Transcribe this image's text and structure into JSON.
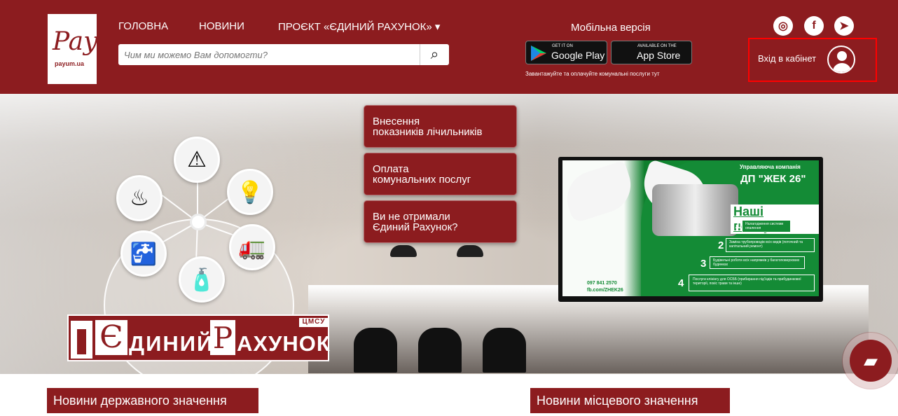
{
  "logo": {
    "script": "Pay",
    "site": "payum.ua"
  },
  "nav": {
    "home": "ГОЛОВНА",
    "news": "НОВИНИ",
    "project": "ПРОЄКТ «ЄДИНИЙ РАХУНОК» ▾"
  },
  "search": {
    "placeholder": "Чим ми можемо Вам допомогти?"
  },
  "mobile": {
    "title": "Мобільна версія",
    "google_sub": "GET IT ON",
    "google_main": "Google Play",
    "apple_sub": "Available on the",
    "apple_main": "App Store",
    "note": "Завантажуйте та оплачуйте комунальні послуги тут"
  },
  "social": [
    "instagram-icon",
    "facebook-icon",
    "telegram-icon"
  ],
  "cabinet": {
    "label": "Вхід в кабінет"
  },
  "quick_links": [
    {
      "label": "Внесення\nпоказників лічильників"
    },
    {
      "label": "Оплата\nкомунальних послуг"
    },
    {
      "label": "Ви не отримали\nЄдиний Рахунок?"
    }
  ],
  "brand": {
    "e": "Є",
    "word1": "ДИНИЙ",
    "p": "Р",
    "word2": "АХУНОК",
    "tag": "ЦМСУ"
  },
  "tv": {
    "company": "Управляюча компанія",
    "name": "ДП \"ЖЕК 26\"",
    "services_title": "Наші послуги:",
    "items": [
      "Налагодження системи опалення",
      "Заміна трубопроводів всіх видів (поточний та капітальний ремонт)",
      "Будівельні роботи всіх напрямків у багатоповерхових будинках",
      "Послуги клінінгу для ОСББ (прибирання підʼїздів та прибудинкової території, покіс трави та інше)"
    ],
    "phone": "097 841 2570",
    "fb": "fb.com/ZHEK26"
  },
  "news": {
    "state": "Новини державного значення",
    "local": "Новини місцевого значення"
  },
  "colors": {
    "brand": "#8c1c1f",
    "highlight": "#ff0000"
  }
}
